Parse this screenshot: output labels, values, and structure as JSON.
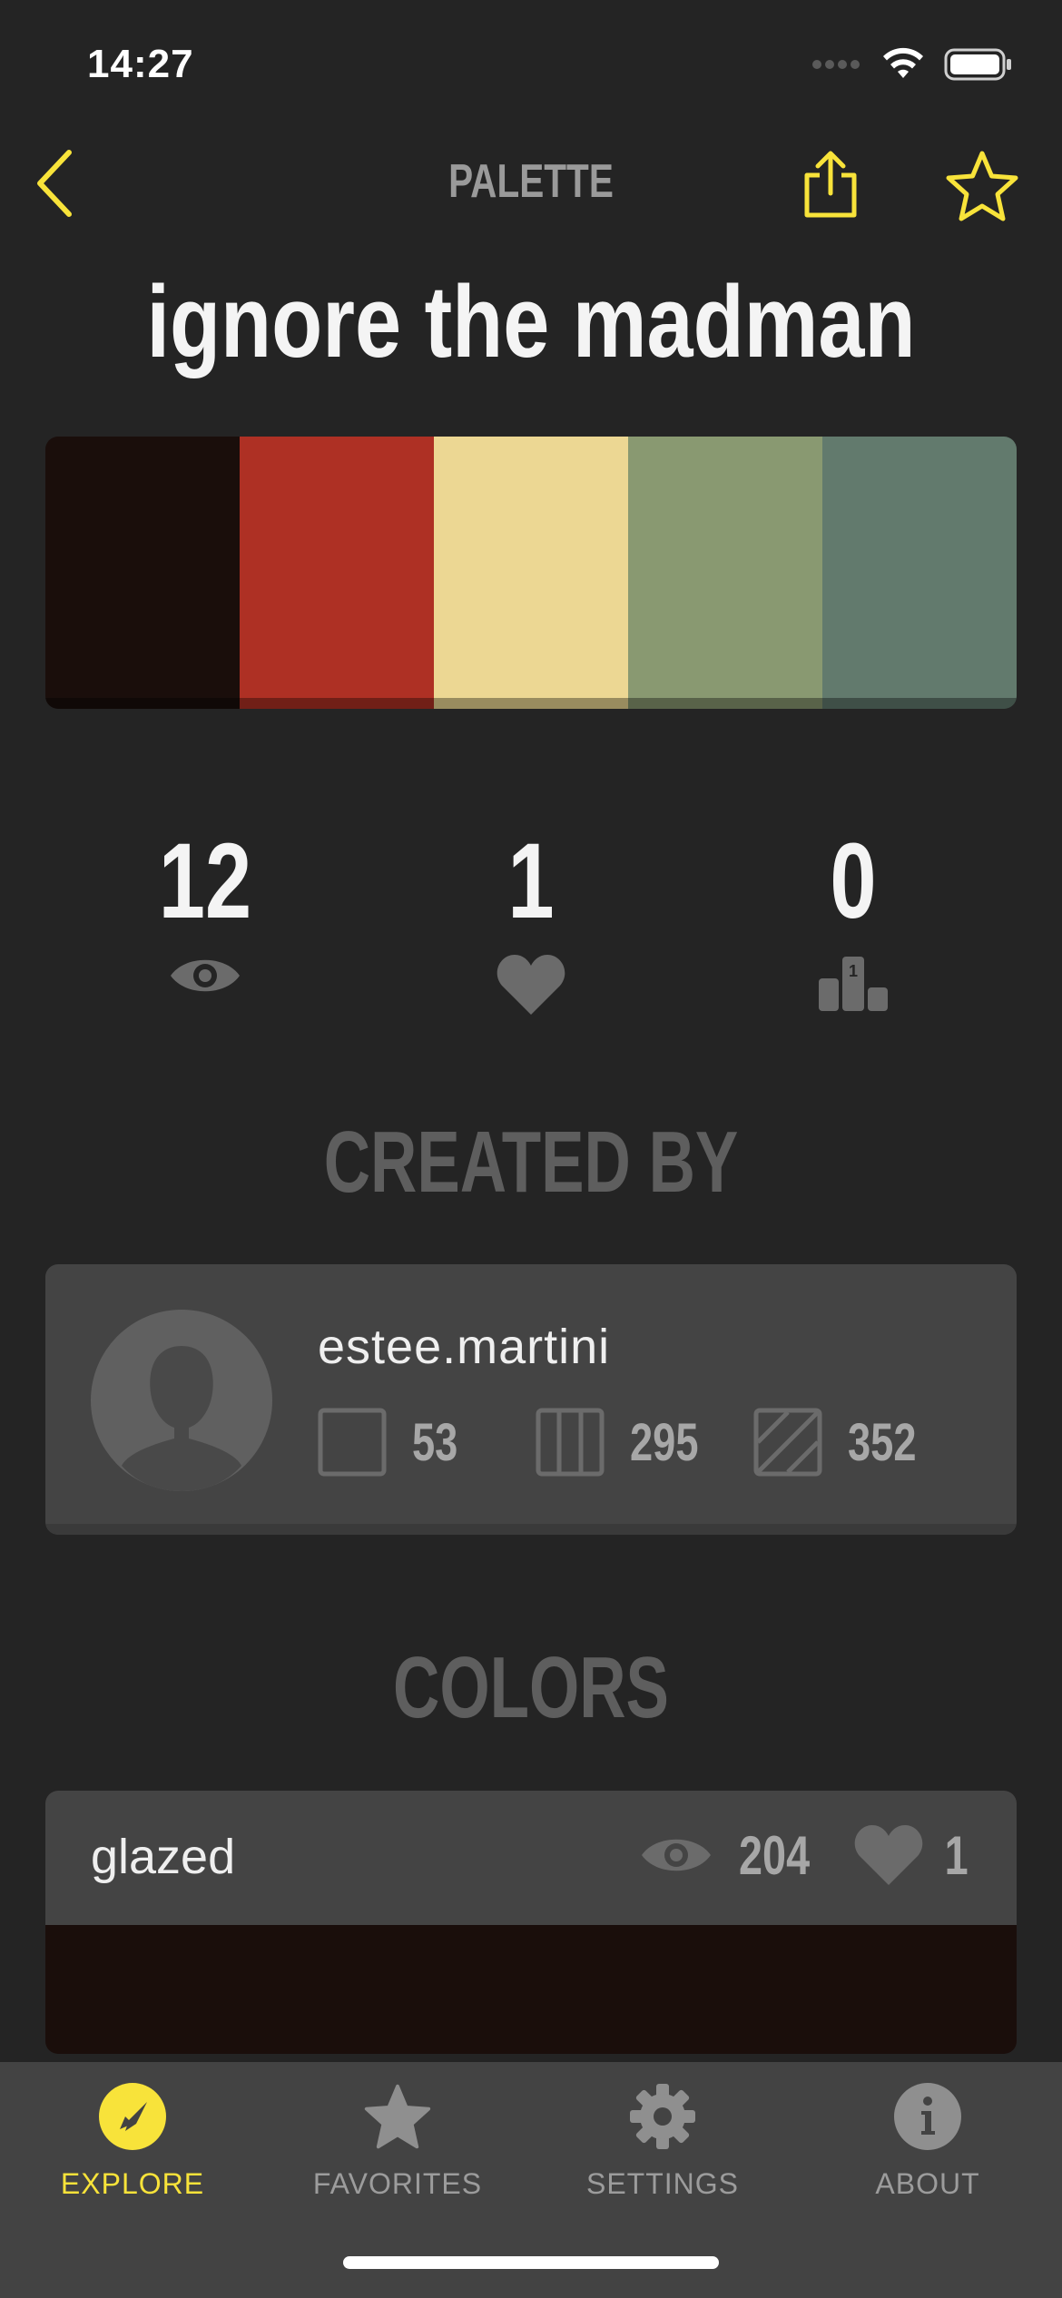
{
  "status_bar": {
    "time": "14:27"
  },
  "header": {
    "title": "PALETTE"
  },
  "palette": {
    "name": "ignore the madman",
    "colors": [
      "#1a0e0b",
      "#ae3024",
      "#ecd793",
      "#899971",
      "#627a6d"
    ]
  },
  "stats": {
    "views": "12",
    "likes": "1",
    "rank": "0"
  },
  "created_by": {
    "heading": "CREATED BY",
    "username": "estee.martini",
    "colors_count": "53",
    "palettes_count": "295",
    "patterns_count": "352"
  },
  "colors_section": {
    "heading": "COLORS",
    "items": [
      {
        "name": "glazed",
        "views": "204",
        "likes": "1",
        "hex": "#1a0e0b"
      }
    ]
  },
  "tabbar": {
    "accent": "#f8e33a",
    "tabs": [
      {
        "label": "EXPLORE",
        "icon": "compass-icon",
        "active": true
      },
      {
        "label": "FAVORITES",
        "icon": "star-icon",
        "active": false
      },
      {
        "label": "SETTINGS",
        "icon": "gear-icon",
        "active": false
      },
      {
        "label": "ABOUT",
        "icon": "info-icon",
        "active": false
      }
    ]
  }
}
